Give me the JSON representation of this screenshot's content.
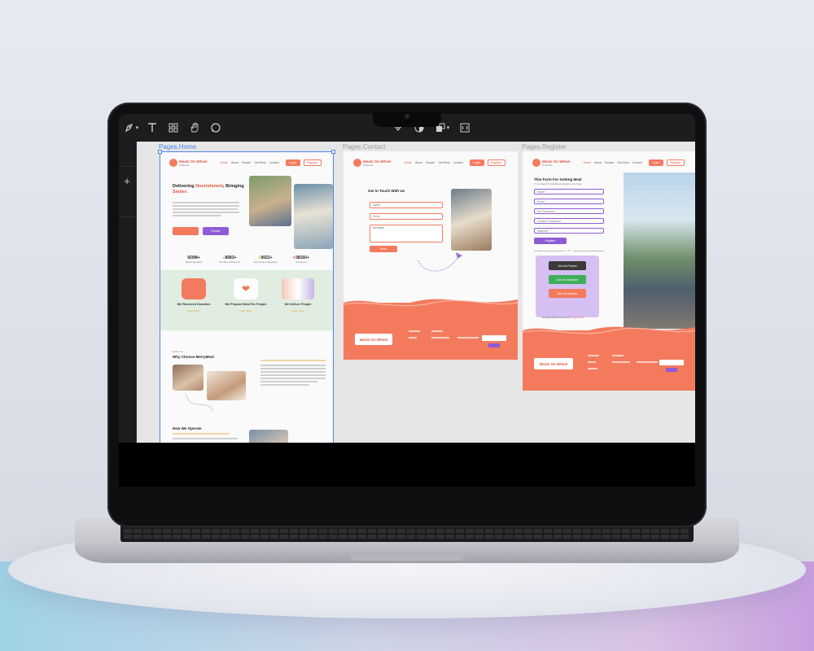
{
  "toolbar": {
    "tools": [
      "pen-tool-icon",
      "text-tool-icon",
      "components-icon",
      "hand-icon",
      "comment-icon"
    ],
    "right_tools": [
      "prototype-icon",
      "contrast-icon",
      "layers-icon",
      "code-icon"
    ]
  },
  "frames": {
    "home": {
      "label": "Pages.Home"
    },
    "contact": {
      "label": "Pages.Contact"
    },
    "register": {
      "label": "Pages.Register"
    }
  },
  "site": {
    "logo": "Meals On Wheel",
    "logo_sub": "Nonprofit",
    "nav": [
      "Home",
      "About",
      "Donate",
      "Get Meal",
      "Contact"
    ],
    "login": "Login",
    "register": "Register"
  },
  "home": {
    "hero_title_a": "Delivering ",
    "hero_title_b": "Nourishment",
    "hero_title_c": ", Bringing",
    "hero_title_d": "Smiles",
    "donate_btn": "Donate",
    "stats": [
      {
        "value": "920M+",
        "label": "Meals Donated"
      },
      {
        "value": "8583+",
        "label": "Donation Received"
      },
      {
        "value": "9022+",
        "label": "Successful Campaign"
      },
      {
        "value": "38160+",
        "label": "Volunteers"
      }
    ],
    "cards": [
      {
        "title": "We Received Donation",
        "link": "Learn More"
      },
      {
        "title": "We Prepare Meal For People",
        "link": "Learn More"
      },
      {
        "title": "We Deliver People",
        "link": "Learn More"
      }
    ],
    "about_small": "About Us",
    "why_title": "Why Choose MerryMeal",
    "operate_title": "How We Operate"
  },
  "contact": {
    "title": "Get in Touch With Us",
    "fields": [
      "Name",
      "Email",
      "Message"
    ],
    "send": "Send"
  },
  "register": {
    "title": "This Form For Getting Meal",
    "subtitle": "If You Need To Get Meals Register For Free",
    "fields": [
      "Name",
      "Email",
      "Set Password",
      "Confirm Password",
      "Address"
    ],
    "submit": "Register",
    "or": "Or",
    "join": [
      "Join As Partner",
      "Join As Volunteer",
      "Join As Donator"
    ],
    "already": "Already Have An Account?",
    "login_link": "Login Here"
  },
  "colors": {
    "coral": "#f47a5e",
    "purple": "#8d5bd6",
    "green": "#3fae5a",
    "panel_green": "#e0ede0"
  }
}
